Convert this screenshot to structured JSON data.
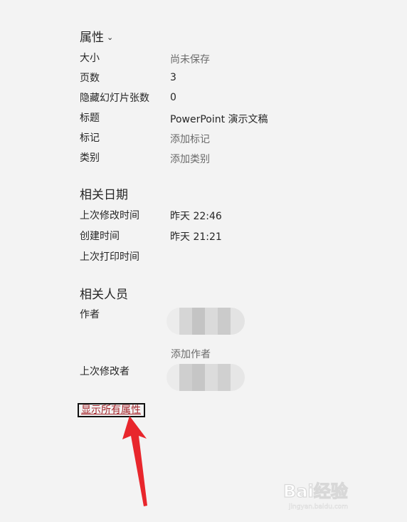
{
  "properties": {
    "title": "属性",
    "rows": [
      {
        "label": "大小",
        "value": "尚未保存"
      },
      {
        "label": "页数",
        "value": "3"
      },
      {
        "label": "隐藏幻灯片张数",
        "value": "0"
      },
      {
        "label": "标题",
        "value": "PowerPoint 演示文稿"
      },
      {
        "label": "标记",
        "value": "添加标记"
      },
      {
        "label": "类别",
        "value": "添加类别"
      }
    ]
  },
  "dates": {
    "title": "相关日期",
    "rows": [
      {
        "label": "上次修改时间",
        "value": "昨天 22:46"
      },
      {
        "label": "创建时间",
        "value": "昨天 21:21"
      },
      {
        "label": "上次打印时间",
        "value": ""
      }
    ]
  },
  "people": {
    "title": "相关人员",
    "author_label": "作者",
    "add_author": "添加作者",
    "last_modified_by_label": "上次修改者"
  },
  "show_all_link": "显示所有属性",
  "watermark": {
    "text": "Bai经验",
    "sub": "jingyan.baidu.com"
  },
  "colors": {
    "background": "#f3f3f3",
    "link": "#a4262c",
    "muted": "#6b6b6b",
    "arrow": "#e8262c"
  }
}
